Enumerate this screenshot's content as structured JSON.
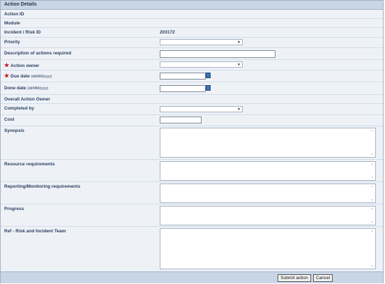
{
  "header": {
    "title": "Action Details"
  },
  "fields": {
    "action_id": {
      "label": "Action ID"
    },
    "module": {
      "label": "Module"
    },
    "incident_risk_id": {
      "label": "Incident / Risk ID",
      "value": "203172"
    },
    "priority": {
      "label": "Priority",
      "value": ""
    },
    "description": {
      "label": "Description of actions required",
      "value": ""
    },
    "action_owner": {
      "label": "Action owner",
      "required": true,
      "value": ""
    },
    "due_date": {
      "label": "Due date",
      "format": "(dd/MM/yyyy)",
      "required": true,
      "value": ""
    },
    "done_date": {
      "label": "Done date",
      "format": "(dd/MM/yyyy)",
      "value": ""
    },
    "overall_owner": {
      "label": "Overall Action Owner"
    },
    "completed_by": {
      "label": "Completed by",
      "value": ""
    },
    "cost": {
      "label": "Cost",
      "value": ""
    },
    "synopsis": {
      "label": "Synopsis",
      "value": ""
    },
    "resource_requirements": {
      "label": "Resource requirements",
      "value": ""
    },
    "reporting_requirements": {
      "label": "Reporting/Monitoring requirements",
      "value": ""
    },
    "progress": {
      "label": "Progress",
      "value": ""
    },
    "ref_team": {
      "label": "Ref - Risk and Incident Team",
      "value": ""
    }
  },
  "buttons": {
    "submit": "Submit action",
    "cancel": "Cancel"
  },
  "colors": {
    "header_bg": "#c9d6e5",
    "form_bg": "#eef2f7",
    "required_star": "#cc1111",
    "calendar_button": "#3a73b8"
  },
  "icons": {
    "required": "red-star",
    "dropdown": "triangle-down",
    "calendar": "calendar-button",
    "scroll_up": "chevron-up",
    "scroll_down": "chevron-down"
  }
}
